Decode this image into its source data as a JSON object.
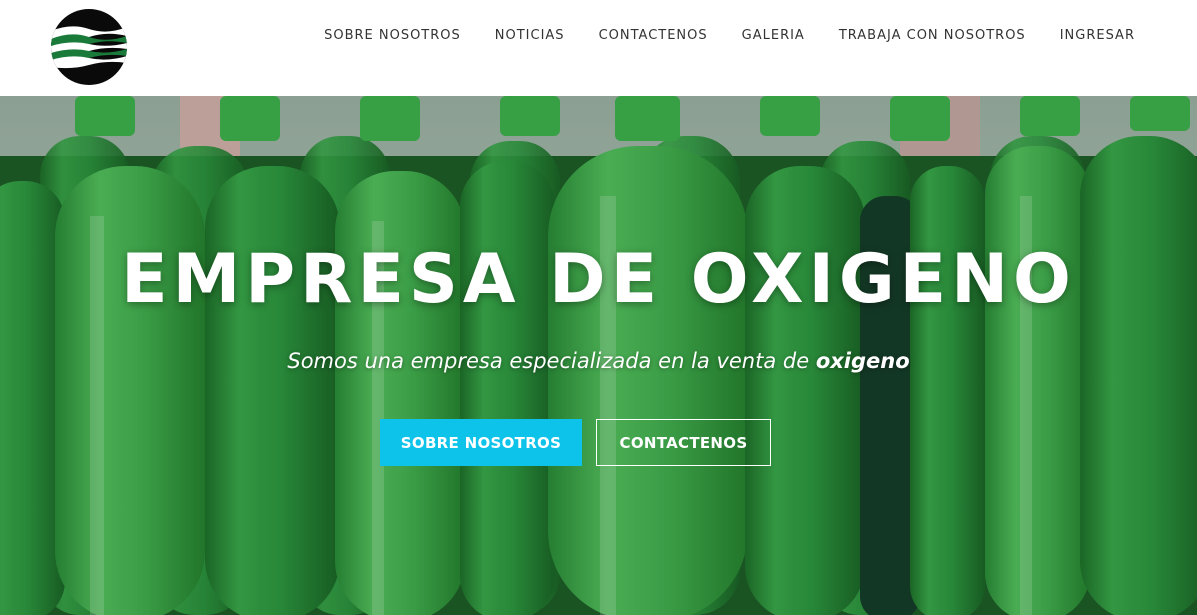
{
  "nav": {
    "items": [
      {
        "label": "SOBRE NOSOTROS"
      },
      {
        "label": "NOTICIAS"
      },
      {
        "label": "CONTACTENOS"
      },
      {
        "label": "GALERIA"
      },
      {
        "label": "TRABAJA CON NOSOTROS"
      },
      {
        "label": "INGRESAR"
      }
    ]
  },
  "hero": {
    "title": "EMPRESA DE OXIGENO",
    "subtitle_prefix": "Somos una empresa especializada en la venta de ",
    "subtitle_emphasis": "oxigeno",
    "primary_button": "SOBRE NOSOTROS",
    "secondary_button": "CONTACTENOS"
  },
  "colors": {
    "accent": "#0dc3ea",
    "cylinder_green": "#2f9a3f",
    "logo_black": "#0a0a0a",
    "logo_green": "#1a7a3a"
  }
}
